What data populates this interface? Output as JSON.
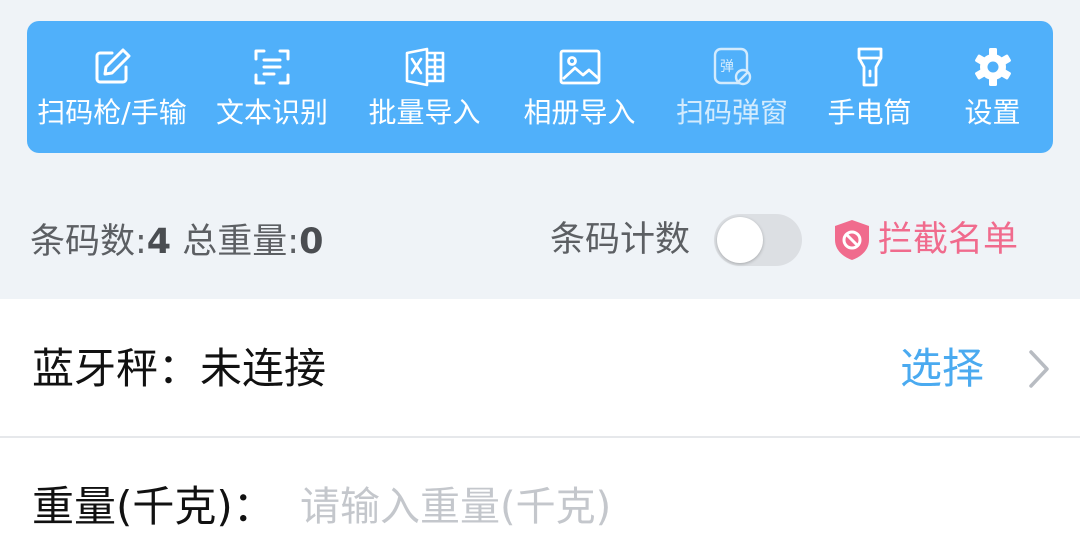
{
  "toolbar": {
    "background": "#50b0fa",
    "items": [
      {
        "label": "扫码枪/手输",
        "icon": "pencil-edit-icon"
      },
      {
        "label": "文本识别",
        "icon": "text-scan-icon"
      },
      {
        "label": "批量导入",
        "icon": "excel-import-icon"
      },
      {
        "label": "相册导入",
        "icon": "image-icon"
      },
      {
        "label": "扫码弹窗",
        "icon": "popup-block-icon"
      },
      {
        "label": "手电筒",
        "icon": "flashlight-icon"
      },
      {
        "label": "设置",
        "icon": "gear-icon"
      }
    ]
  },
  "stats": {
    "count_label": "条码数:",
    "count_value": "4",
    "weight_label": "总重量:",
    "weight_value": "0",
    "toggle_label": "条码计数",
    "toggle_on": false,
    "blocklist_label": "拦截名单",
    "blocklist_color": "#f06b8d"
  },
  "bluetooth": {
    "label": "蓝牙秤：",
    "status": "未连接",
    "select_label": "选择",
    "accent": "#4aaaf0"
  },
  "weight": {
    "label": "重量(千克)：",
    "placeholder": "请输入重量(千克)",
    "value": ""
  }
}
